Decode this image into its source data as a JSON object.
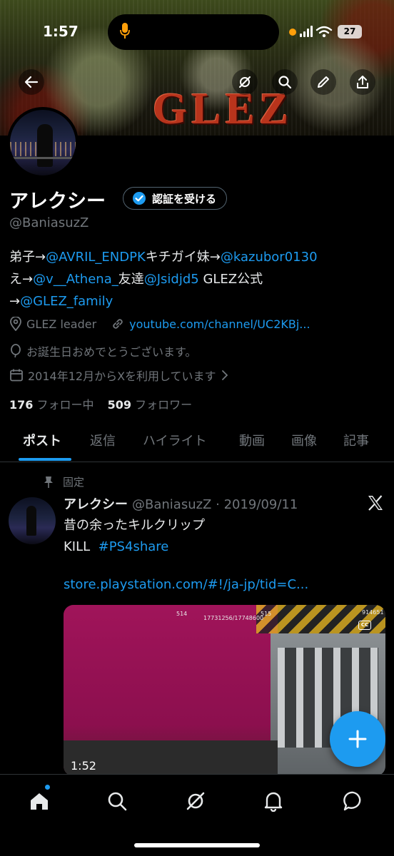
{
  "status_bar": {
    "time": "1:57",
    "battery": "27"
  },
  "banner": {
    "logo_text": "GLEZ"
  },
  "profile": {
    "name": "アレクシー",
    "verify_button": "認証を受ける",
    "handle": "@BaniasuzZ",
    "bio": {
      "p1": "弟子→",
      "m1": "@AVRIL_ENDPK",
      "p2": "キチガイ妹→",
      "m2": "@kazubor0130",
      "p3": "え→",
      "m3": "@v__Athena_",
      "p4": "友達",
      "m4": "@Jsidjd5",
      "p5": " GLEZ公式",
      "p6": "→",
      "m5": "@GLEZ_family"
    },
    "location": "GLEZ leader",
    "website": "youtube.com/channel/UC2KBj...",
    "birthday": "お誕生日おめでとうございます。",
    "joined": "2014年12月からXを利用しています",
    "following_count": "176",
    "following_label": "フォロー中",
    "followers_count": "509",
    "followers_label": "フォロワー"
  },
  "tabs": [
    "ポスト",
    "返信",
    "ハイライト",
    "動画",
    "画像",
    "記事"
  ],
  "post": {
    "pinned_label": "固定",
    "author": "アレクシー",
    "handle": "@BaniasuzZ",
    "date": "· 2019/09/11",
    "line1": "昔の余ったキルクリップ",
    "line2a": "KILL",
    "hashtag": "#PS4share",
    "link": "store.playstation.com/#!/ja-jp/tid=C...",
    "media": {
      "hud_left": "514",
      "hud_right": "515",
      "hud_score": "17731256/17748600",
      "hud_corner": "914651",
      "cc": "CC",
      "duration": "1:52"
    }
  },
  "colors": {
    "accent": "#1d9bf0",
    "background": "#000000",
    "muted": "#71767b"
  }
}
